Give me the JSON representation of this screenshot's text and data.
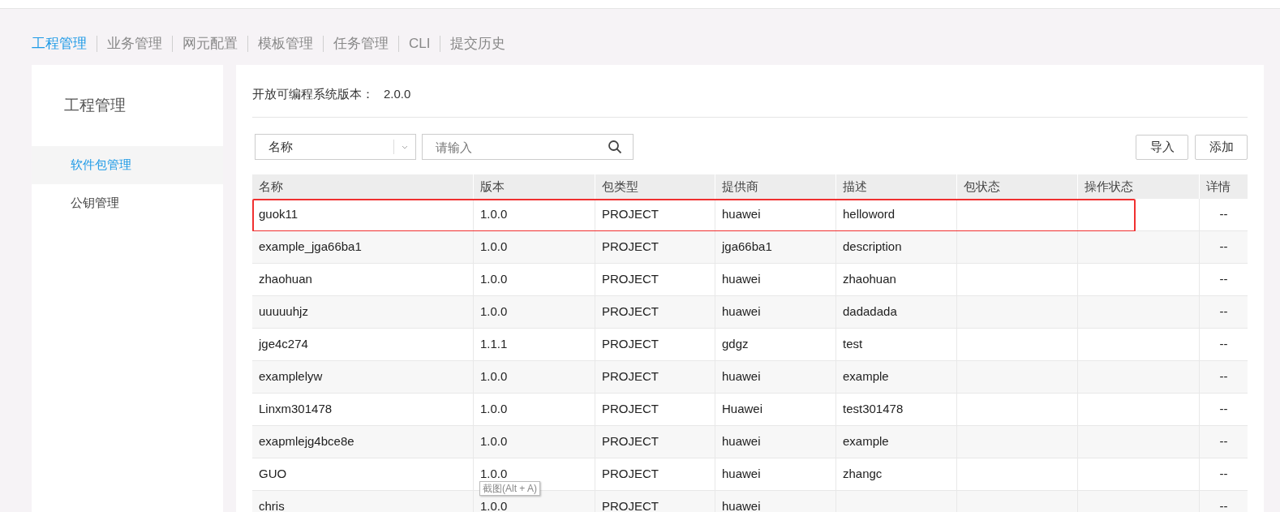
{
  "tabs": [
    {
      "label": "工程管理",
      "selected": true
    },
    {
      "label": "业务管理",
      "selected": false
    },
    {
      "label": "网元配置",
      "selected": false
    },
    {
      "label": "模板管理",
      "selected": false
    },
    {
      "label": "任务管理",
      "selected": false
    },
    {
      "label": "CLI",
      "selected": false
    },
    {
      "label": "提交历史",
      "selected": false
    }
  ],
  "sidebar": {
    "title": "工程管理",
    "items": [
      {
        "label": "软件包管理",
        "selected": true
      },
      {
        "label": "公钥管理",
        "selected": false
      }
    ]
  },
  "version": {
    "label": "开放可编程系统版本：",
    "value": "2.0.0"
  },
  "filter": {
    "select": "名称",
    "placeholder": "请输入"
  },
  "buttons": [
    "导入",
    "添加"
  ],
  "table": {
    "columns": [
      "名称",
      "版本",
      "包类型",
      "提供商",
      "描述",
      "包状态",
      "操作状态",
      "详情"
    ],
    "rows": [
      {
        "cells": [
          "guok11",
          "1.0.0",
          "PROJECT",
          "huawei",
          "helloword",
          "",
          "",
          "--"
        ],
        "highlighted": true
      },
      {
        "cells": [
          "example_jga66ba1",
          "1.0.0",
          "PROJECT",
          "jga66ba1",
          "description",
          "",
          "",
          "--"
        ],
        "highlighted": false
      },
      {
        "cells": [
          "zhaohuan",
          "1.0.0",
          "PROJECT",
          "huawei",
          "zhaohuan",
          "",
          "",
          "--"
        ],
        "highlighted": false
      },
      {
        "cells": [
          "uuuuuhjz",
          "1.0.0",
          "PROJECT",
          "huawei",
          "dadadada",
          "",
          "",
          "--"
        ],
        "highlighted": false
      },
      {
        "cells": [
          "jge4c274",
          "1.1.1",
          "PROJECT",
          "gdgz",
          "test",
          "",
          "",
          "--"
        ],
        "highlighted": false
      },
      {
        "cells": [
          "examplelyw",
          "1.0.0",
          "PROJECT",
          "huawei",
          "example",
          "",
          "",
          "--"
        ],
        "highlighted": false
      },
      {
        "cells": [
          "Linxm301478",
          "1.0.0",
          "PROJECT",
          "Huawei",
          "test301478",
          "",
          "",
          "--"
        ],
        "highlighted": false
      },
      {
        "cells": [
          "exapmlejg4bce8e",
          "1.0.0",
          "PROJECT",
          "huawei",
          "example",
          "",
          "",
          "--"
        ],
        "highlighted": false
      },
      {
        "cells": [
          "GUO",
          "1.0.0",
          "PROJECT",
          "huawei",
          "zhangc",
          "",
          "",
          "--"
        ],
        "highlighted": false
      },
      {
        "cells": [
          "chris",
          "1.0.0",
          "PROJECT",
          "huawei",
          "",
          "",
          "",
          "--"
        ],
        "highlighted": false
      }
    ]
  },
  "tooltip": "截图(Alt + A)"
}
